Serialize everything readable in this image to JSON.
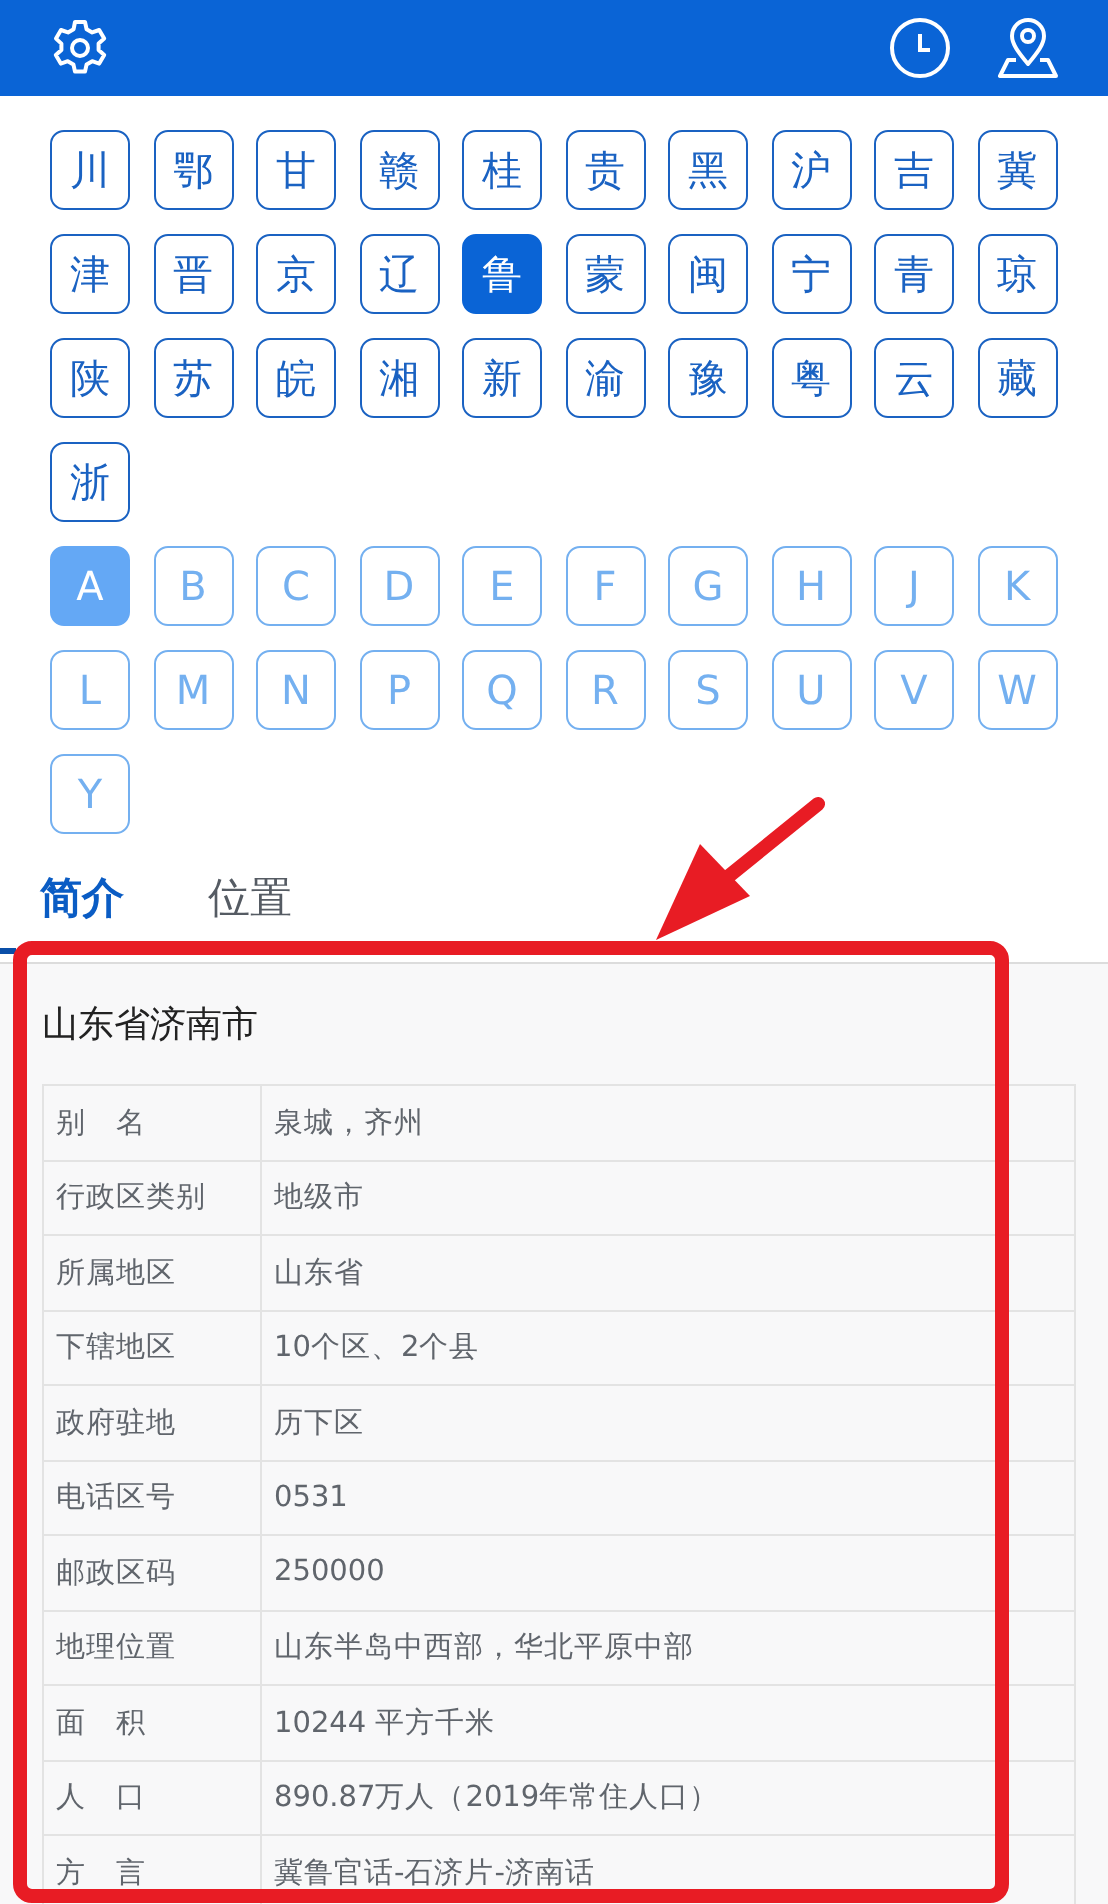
{
  "provinces": [
    {
      "label": "川",
      "selected": false
    },
    {
      "label": "鄂",
      "selected": false
    },
    {
      "label": "甘",
      "selected": false
    },
    {
      "label": "赣",
      "selected": false
    },
    {
      "label": "桂",
      "selected": false
    },
    {
      "label": "贵",
      "selected": false
    },
    {
      "label": "黑",
      "selected": false
    },
    {
      "label": "沪",
      "selected": false
    },
    {
      "label": "吉",
      "selected": false
    },
    {
      "label": "冀",
      "selected": false
    },
    {
      "label": "津",
      "selected": false
    },
    {
      "label": "晋",
      "selected": false
    },
    {
      "label": "京",
      "selected": false
    },
    {
      "label": "辽",
      "selected": false
    },
    {
      "label": "鲁",
      "selected": true
    },
    {
      "label": "蒙",
      "selected": false
    },
    {
      "label": "闽",
      "selected": false
    },
    {
      "label": "宁",
      "selected": false
    },
    {
      "label": "青",
      "selected": false
    },
    {
      "label": "琼",
      "selected": false
    },
    {
      "label": "陕",
      "selected": false
    },
    {
      "label": "苏",
      "selected": false
    },
    {
      "label": "皖",
      "selected": false
    },
    {
      "label": "湘",
      "selected": false
    },
    {
      "label": "新",
      "selected": false
    },
    {
      "label": "渝",
      "selected": false
    },
    {
      "label": "豫",
      "selected": false
    },
    {
      "label": "粤",
      "selected": false
    },
    {
      "label": "云",
      "selected": false
    },
    {
      "label": "藏",
      "selected": false
    },
    {
      "label": "浙",
      "selected": false
    }
  ],
  "letters": [
    {
      "label": "A",
      "selected": true
    },
    {
      "label": "B",
      "selected": false
    },
    {
      "label": "C",
      "selected": false
    },
    {
      "label": "D",
      "selected": false
    },
    {
      "label": "E",
      "selected": false
    },
    {
      "label": "F",
      "selected": false
    },
    {
      "label": "G",
      "selected": false
    },
    {
      "label": "H",
      "selected": false
    },
    {
      "label": "J",
      "selected": false
    },
    {
      "label": "K",
      "selected": false
    },
    {
      "label": "L",
      "selected": false
    },
    {
      "label": "M",
      "selected": false
    },
    {
      "label": "N",
      "selected": false
    },
    {
      "label": "P",
      "selected": false
    },
    {
      "label": "Q",
      "selected": false
    },
    {
      "label": "R",
      "selected": false
    },
    {
      "label": "S",
      "selected": false
    },
    {
      "label": "U",
      "selected": false
    },
    {
      "label": "V",
      "selected": false
    },
    {
      "label": "W",
      "selected": false
    },
    {
      "label": "Y",
      "selected": false
    }
  ],
  "tabs": [
    {
      "label": "简介",
      "selected": true
    },
    {
      "label": "位置",
      "selected": false
    }
  ],
  "card": {
    "title": "山东省济南市",
    "rows": [
      {
        "key": "别　名",
        "value": "泉城，齐州"
      },
      {
        "key": "行政区类别",
        "value": "地级市"
      },
      {
        "key": "所属地区",
        "value": "山东省"
      },
      {
        "key": "下辖地区",
        "value": "10个区、2个县"
      },
      {
        "key": "政府驻地",
        "value": "历下区"
      },
      {
        "key": "电话区号",
        "value": "0531"
      },
      {
        "key": "邮政区码",
        "value": "250000"
      },
      {
        "key": "地理位置",
        "value": "山东半岛中西部，华北平原中部"
      },
      {
        "key": "面　积",
        "value": "10244 平方千米"
      },
      {
        "key": "人　口",
        "value": "890.87万人（2019年常住人口）"
      },
      {
        "key": "方　言",
        "value": "冀鲁官话-石济片-济南话"
      }
    ]
  }
}
